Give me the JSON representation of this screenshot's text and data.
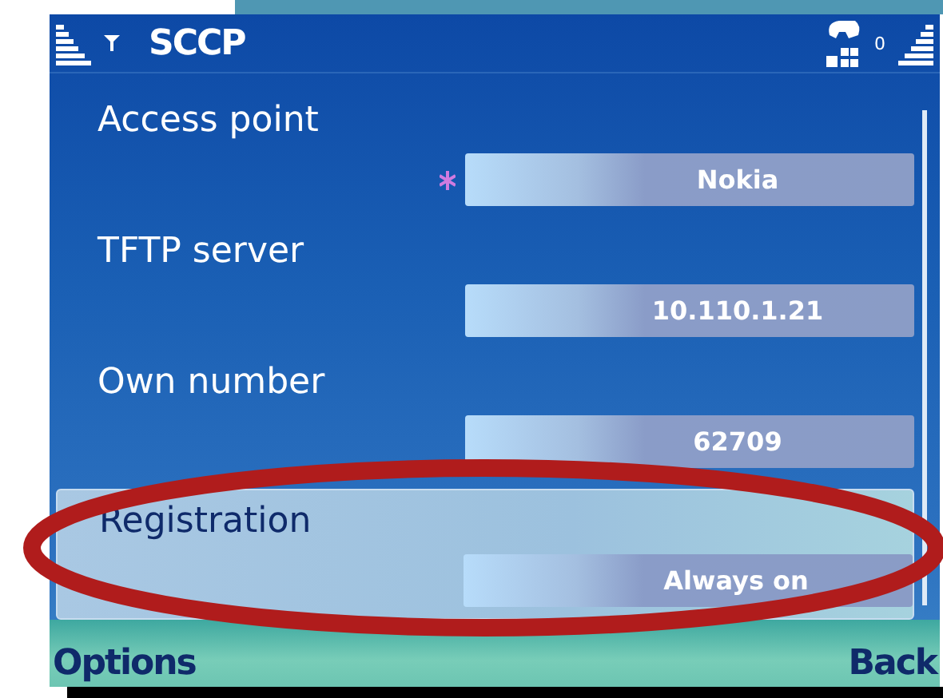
{
  "title_bar": {
    "title": "SCCP",
    "message_count": "0"
  },
  "settings": [
    {
      "label": "Access point",
      "value": "Nokia",
      "marked": true,
      "selected": false
    },
    {
      "label": "TFTP server",
      "value": "10.110.1.21",
      "marked": false,
      "selected": false
    },
    {
      "label": "Own number",
      "value": "62709",
      "marked": false,
      "selected": false
    },
    {
      "label": "Registration",
      "value": "Always on",
      "marked": false,
      "selected": true
    }
  ],
  "softkeys": {
    "left": "Options",
    "right": "Back"
  }
}
